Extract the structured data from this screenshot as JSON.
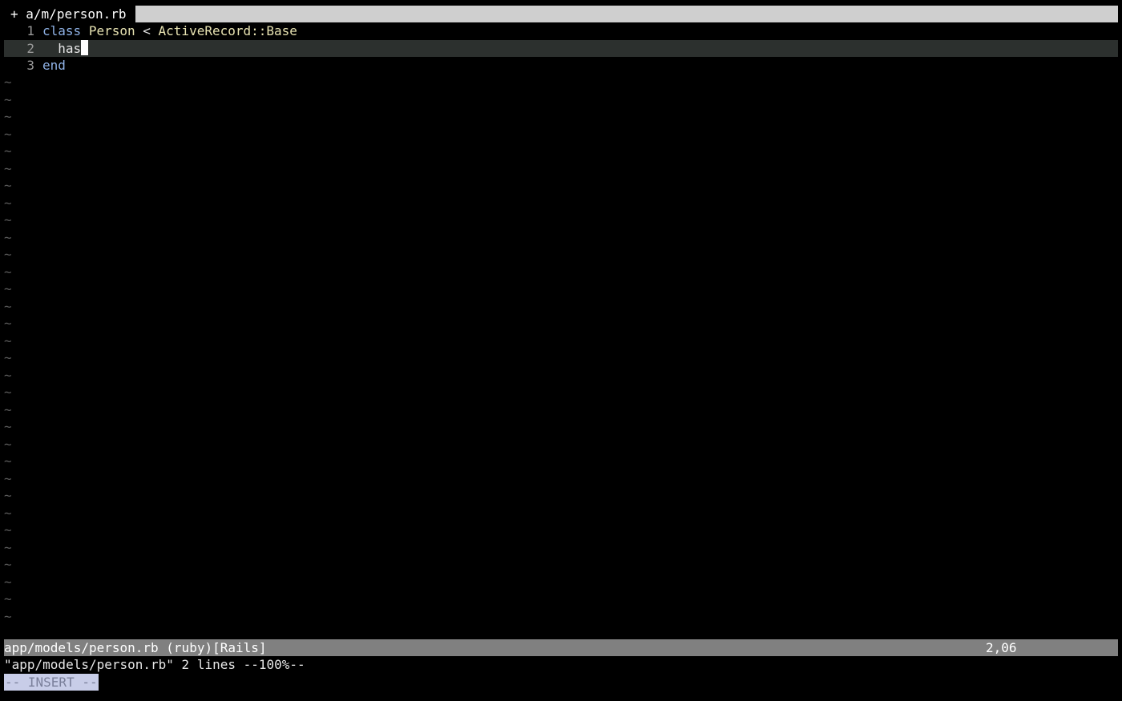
{
  "tabline": {
    "modified_marker": "+",
    "tab_label": "a/m/person.rb"
  },
  "buffer": {
    "lines": [
      {
        "number": "1",
        "tokens": {
          "kw1": "class",
          "name": "Person",
          "op": "<",
          "base": "ActiveRecord::Base"
        }
      },
      {
        "number": "2",
        "text": "  has"
      },
      {
        "number": "3",
        "kw": "end"
      }
    ],
    "empty_line_marker": "~"
  },
  "statusline": {
    "file_info": "app/models/person.rb (ruby)[Rails]",
    "position": "2,06"
  },
  "message_line": "\"app/models/person.rb\" 2 lines --100%--",
  "mode_indicator": "-- INSERT --",
  "colors": {
    "background": "#000000",
    "keyword": "#8fb2e6",
    "class_name": "#e8e3b2",
    "statusline_bg": "#808080",
    "tabline_fill": "#cfcfcf",
    "cursorline": "#2c302e"
  }
}
